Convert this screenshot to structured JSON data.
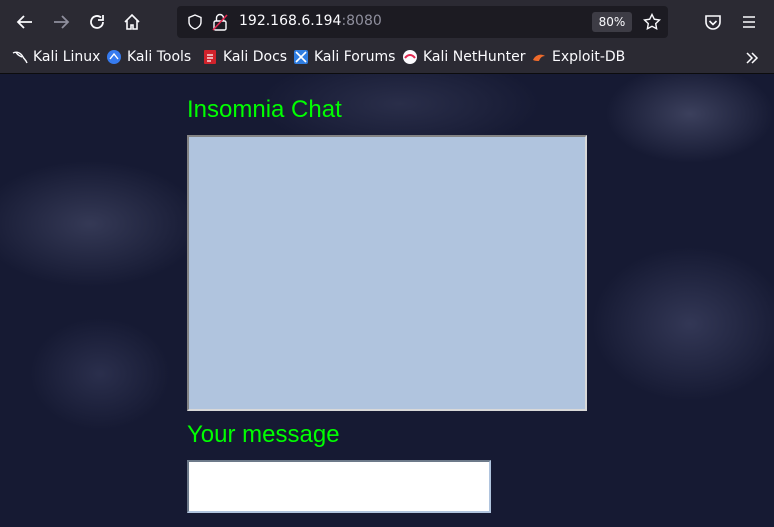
{
  "browser": {
    "url_host": "192.168.6.194",
    "url_port": ":8080",
    "zoom": "80%",
    "bookmarks": [
      {
        "label": "Kali Linux",
        "icon": "kali-dragon-icon"
      },
      {
        "label": "Kali Tools",
        "icon": "kali-tools-icon"
      },
      {
        "label": "Kali Docs",
        "icon": "kali-docs-icon"
      },
      {
        "label": "Kali Forums",
        "icon": "kali-forums-icon"
      },
      {
        "label": "Kali NetHunter",
        "icon": "kali-nethunter-icon"
      },
      {
        "label": "Exploit-DB",
        "icon": "exploit-db-icon"
      }
    ]
  },
  "page": {
    "title": "Insomnia Chat",
    "message_label": "Your message",
    "chat_log": "",
    "message_value": "",
    "colors": {
      "heading": "#00ff00",
      "chatbox": "#b0c4de",
      "background": "#161a33"
    }
  }
}
